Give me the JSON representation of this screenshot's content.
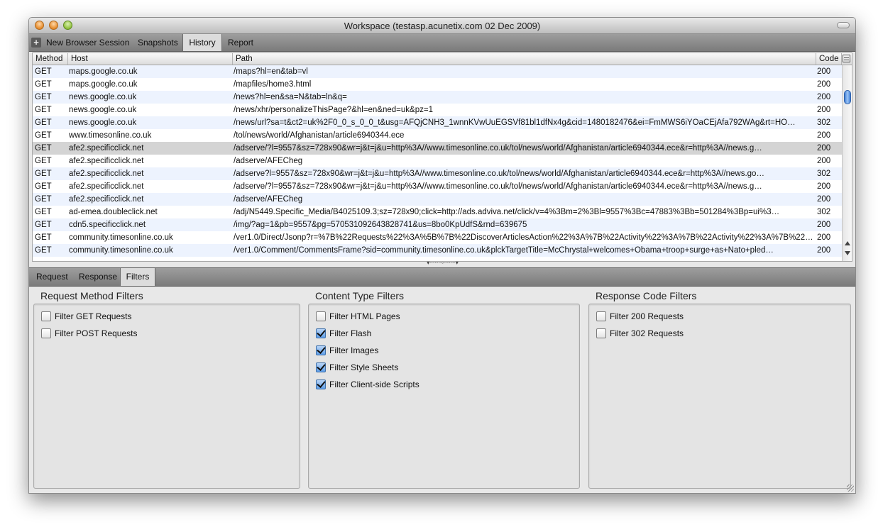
{
  "window": {
    "title": "Workspace (testasp.acunetix.com 02 Dec 2009)"
  },
  "toolbar": {
    "new_session": "New Browser Session",
    "snapshots": "Snapshots",
    "history": "History",
    "report": "Report"
  },
  "table": {
    "headers": {
      "method": "Method",
      "host": "Host",
      "path": "Path",
      "code": "Code"
    },
    "rows": [
      {
        "method": "GET",
        "host": "maps.google.co.uk",
        "path": "/maps?hl=en&tab=vl",
        "code": "200"
      },
      {
        "method": "GET",
        "host": "maps.google.co.uk",
        "path": "/mapfiles/home3.html",
        "code": "200"
      },
      {
        "method": "GET",
        "host": "news.google.co.uk",
        "path": "/news?hl=en&sa=N&tab=ln&q=",
        "code": "200"
      },
      {
        "method": "GET",
        "host": "news.google.co.uk",
        "path": "/news/xhr/personalizeThisPage?&hl=en&ned=uk&pz=1",
        "code": "200"
      },
      {
        "method": "GET",
        "host": "news.google.co.uk",
        "path": "/news/url?sa=t&ct2=uk%2F0_0_s_0_0_t&usg=AFQjCNH3_1wnnKVwUuEGSVf81bl1dfNx4g&cid=1480182476&ei=FmMWS6iYOaCEjAfa792WAg&rt=HO…",
        "code": "302"
      },
      {
        "method": "GET",
        "host": "www.timesonline.co.uk",
        "path": "/tol/news/world/Afghanistan/article6940344.ece",
        "code": "200"
      },
      {
        "method": "GET",
        "host": "afe2.specificclick.net",
        "path": "/adserve/?l=9557&sz=728x90&wr=j&t=j&u=http%3A//www.timesonline.co.uk/tol/news/world/Afghanistan/article6940344.ece&r=http%3A//news.g…",
        "code": "200"
      },
      {
        "method": "GET",
        "host": "afe2.specificclick.net",
        "path": "/adserve/AFECheg",
        "code": "200"
      },
      {
        "method": "GET",
        "host": "afe2.specificclick.net",
        "path": "/adserve?l=9557&sz=728x90&wr=j&t=j&u=http%3A//www.timesonline.co.uk/tol/news/world/Afghanistan/article6940344.ece&r=http%3A//news.go…",
        "code": "302"
      },
      {
        "method": "GET",
        "host": "afe2.specificclick.net",
        "path": "/adserve/?l=9557&sz=728x90&wr=j&t=j&u=http%3A//www.timesonline.co.uk/tol/news/world/Afghanistan/article6940344.ece&r=http%3A//news.g…",
        "code": "200"
      },
      {
        "method": "GET",
        "host": "afe2.specificclick.net",
        "path": "/adserve/AFECheg",
        "code": "200"
      },
      {
        "method": "GET",
        "host": "ad-emea.doubleclick.net",
        "path": "/adj/N5449.Specific_Media/B4025109.3;sz=728x90;click=http://ads.adviva.net/click/v=4%3Bm=2%3Bl=9557%3Bc=47883%3Bb=501284%3Bp=ui%3…",
        "code": "302"
      },
      {
        "method": "GET",
        "host": "cdn5.specificclick.net",
        "path": "/img/?ag=1&pb=9557&pg=570531092643828741&us=8bo0KpUdfS&rnd=639675",
        "code": "200"
      },
      {
        "method": "GET",
        "host": "community.timesonline.co.uk",
        "path": "/ver1.0/Direct/Jsonp?r=%7B%22Requests%22%3A%5B%7B%22DiscoverArticlesAction%22%3A%7B%22Activity%22%3A%7B%22Activity%22%3A%7B%22Nam…",
        "code": "200"
      },
      {
        "method": "GET",
        "host": "community.timesonline.co.uk",
        "path": "/ver1.0/Comment/CommentsFrame?sid=community.timesonline.co.uk&plckTargetTitle=McChrystal+welcomes+Obama+troop+surge+as+Nato+pled…",
        "code": "200"
      }
    ]
  },
  "bottom_tabs": {
    "request": "Request",
    "response": "Response",
    "filters": "Filters"
  },
  "filters": {
    "method": {
      "title": "Request Method Filters",
      "items": [
        {
          "label": "Filter GET Requests",
          "checked": false
        },
        {
          "label": "Filter POST Requests",
          "checked": false
        }
      ]
    },
    "content": {
      "title": "Content Type Filters",
      "items": [
        {
          "label": "Filter HTML Pages",
          "checked": false
        },
        {
          "label": "Filter Flash",
          "checked": true
        },
        {
          "label": "Filter Images",
          "checked": true
        },
        {
          "label": "Filter Style Sheets",
          "checked": true
        },
        {
          "label": "Filter Client-side Scripts",
          "checked": true
        }
      ]
    },
    "response": {
      "title": "Response Code Filters",
      "items": [
        {
          "label": "Filter 200 Requests",
          "checked": false
        },
        {
          "label": "Filter 302 Requests",
          "checked": false
        }
      ]
    }
  }
}
